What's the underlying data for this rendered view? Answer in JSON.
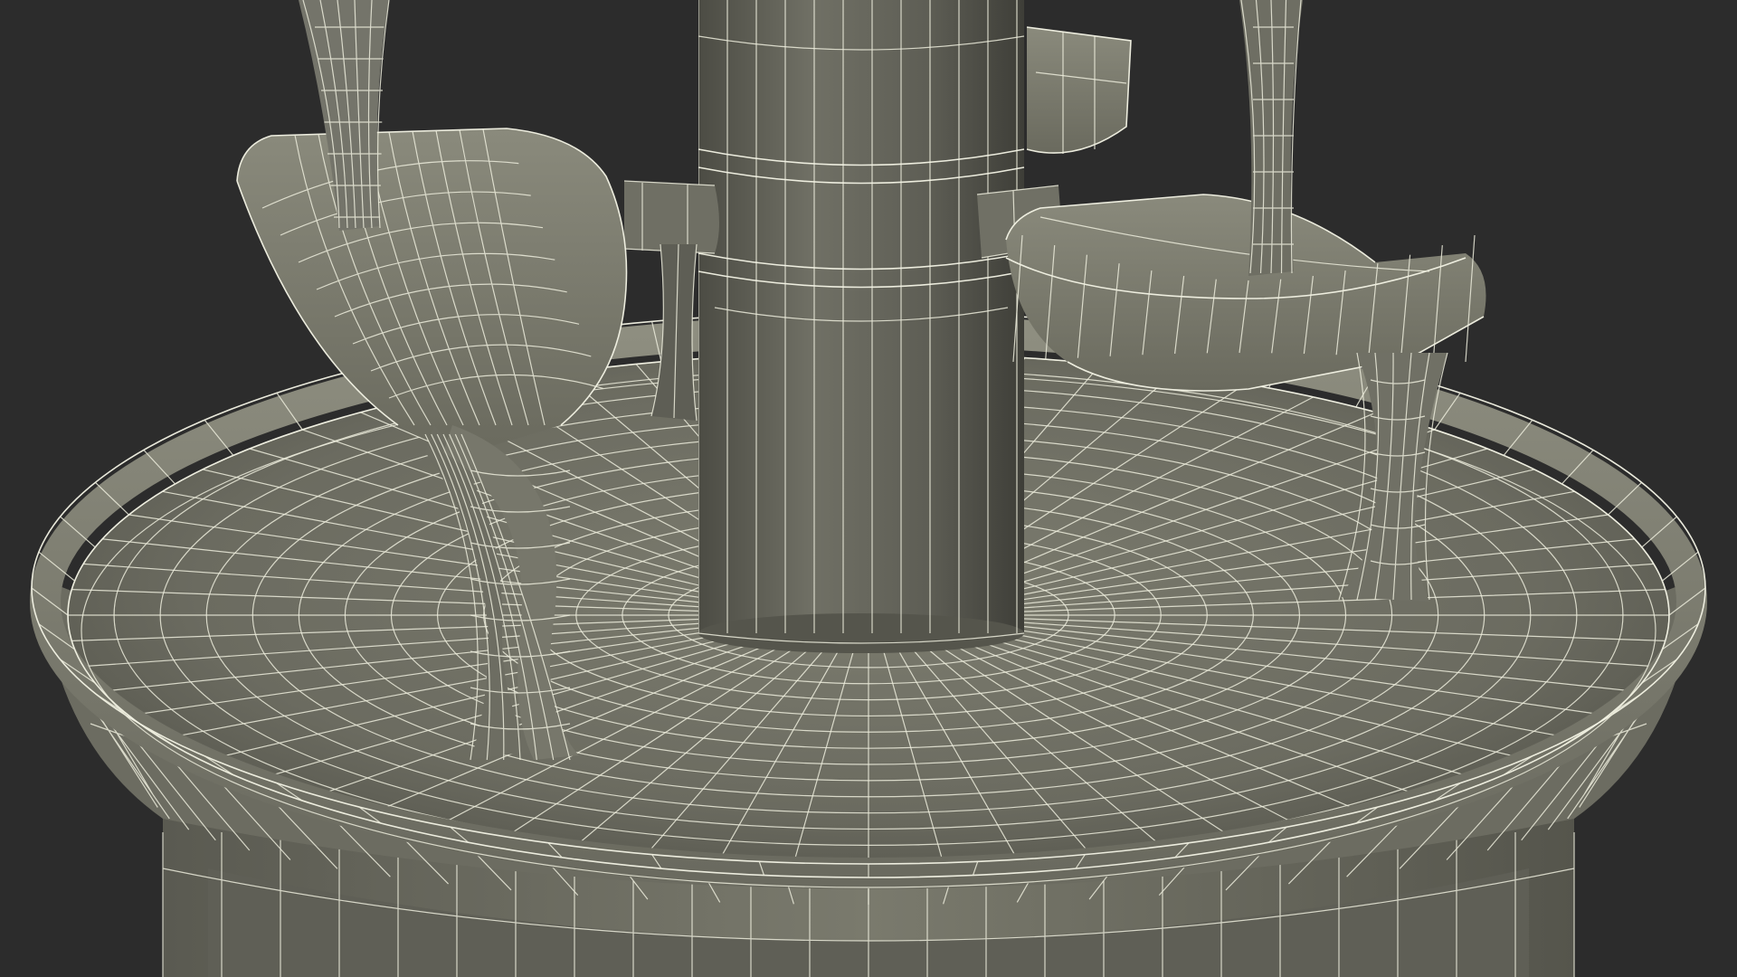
{
  "scene": {
    "description_colors": {
      "background": "#2c2c2c",
      "surface_light": "#8a8a7c",
      "surface_mid": "#6f6f63",
      "surface_dark": "#4a4a42",
      "wire": "#ececdc"
    }
  }
}
